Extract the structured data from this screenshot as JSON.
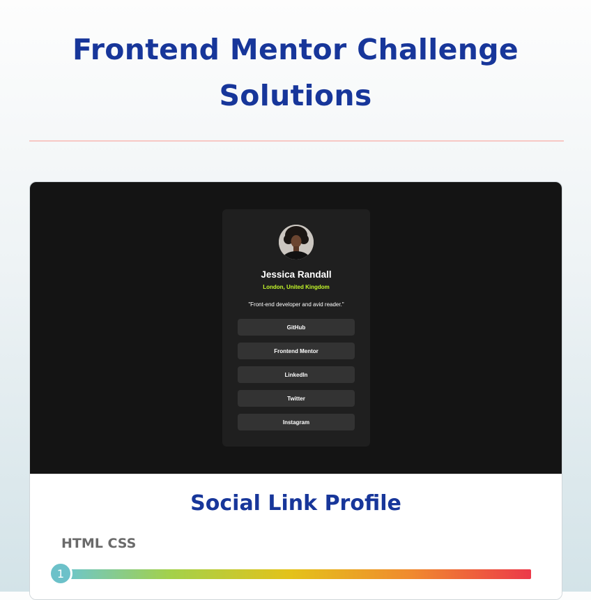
{
  "page": {
    "title": "Frontend Mentor Challenge Solutions"
  },
  "colors": {
    "title": "#17369a",
    "divider": "#f7c8c4",
    "preview_bg": "#141414",
    "profile_card": "#1f1f1f",
    "link_button": "#333333",
    "location": "#c4f82a",
    "tech_label": "#6a6a6a",
    "step_badge": "#6cc1c9"
  },
  "profile": {
    "name": "Jessica Randall",
    "location": "London, United Kingdom",
    "bio": "\"Front-end developer and avid reader.\"",
    "avatar_icon": "avatar-photo",
    "links": [
      {
        "label": "GitHub"
      },
      {
        "label": "Frontend Mentor"
      },
      {
        "label": "LinkedIn"
      },
      {
        "label": "Twitter"
      },
      {
        "label": "Instagram"
      }
    ]
  },
  "project": {
    "title": "Social Link Profile",
    "tech": "HTML CSS",
    "step": "1"
  }
}
